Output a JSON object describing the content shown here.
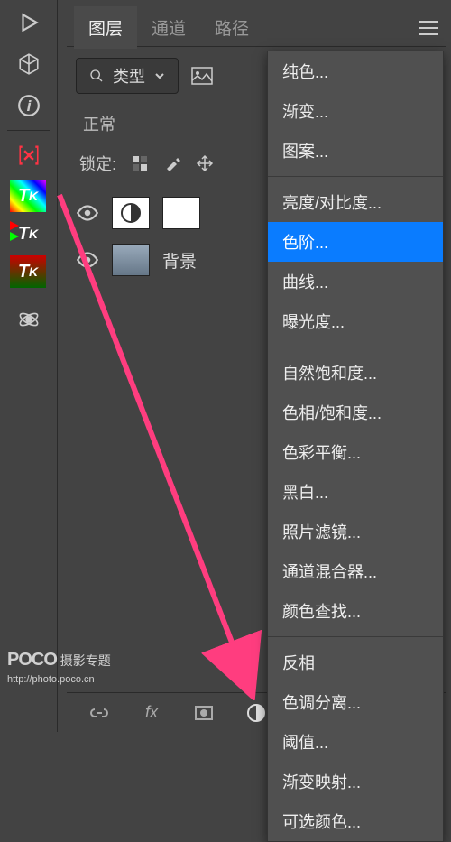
{
  "tabs": {
    "layers": "图层",
    "channels": "通道",
    "paths": "路径"
  },
  "filter": {
    "type_label": "类型"
  },
  "blend_mode": "正常",
  "lock_label": "锁定:",
  "layers_list": [
    {
      "name": ""
    },
    {
      "name": "背景"
    }
  ],
  "menu": {
    "solid": "纯色...",
    "gradient": "渐变...",
    "pattern": "图案...",
    "brightness": "亮度/对比度...",
    "levels": "色阶...",
    "curves": "曲线...",
    "exposure": "曝光度...",
    "vibrance": "自然饱和度...",
    "hue": "色相/饱和度...",
    "balance": "色彩平衡...",
    "bw": "黑白...",
    "photofilter": "照片滤镜...",
    "mixer": "通道混合器...",
    "lookup": "颜色查找...",
    "invert": "反相",
    "posterize": "色调分离...",
    "threshold": "阈值...",
    "gradmap": "渐变映射...",
    "selective": "可选颜色..."
  },
  "watermark": {
    "brand": "POCO",
    "sub": "摄影专题",
    "url": "http://photo.poco.cn"
  }
}
